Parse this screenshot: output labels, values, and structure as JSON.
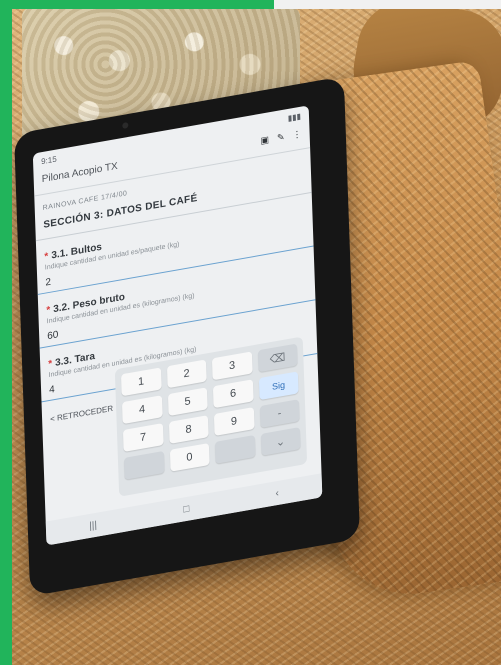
{
  "tablet_screen": {
    "status_text": "9:15",
    "app_title": "Pilona Acopio TX",
    "toolbar_icons": [
      "save-icon",
      "tools-icon",
      "more-icon"
    ],
    "form_label_small": "RAINOVA CAFE 17/4/00",
    "section_title": "SECCIÓN 3: DATOS DEL CAFÉ",
    "fields": [
      {
        "label": "3.1. Bultos",
        "hint": "Indique cantidad en unidad es/paquete (kg)",
        "value": "2"
      },
      {
        "label": "3.2. Peso bruto",
        "hint": "Indique cantidad en unidad es (kilogramos) (kg)",
        "value": "60"
      },
      {
        "label": "3.3. Tara",
        "hint": "Indique cantidad en unidad es (kilogramos) (kg)",
        "value": "4"
      }
    ],
    "back_label": "< RETROCEDER",
    "keypad": {
      "row1": [
        "1",
        "2",
        "3",
        "⌫"
      ],
      "row2": [
        "4",
        "5",
        "6",
        "Sig"
      ],
      "row3": [
        "7",
        "8",
        "9",
        "-"
      ],
      "row4": [
        "",
        "0",
        "",
        "⌄"
      ]
    }
  }
}
